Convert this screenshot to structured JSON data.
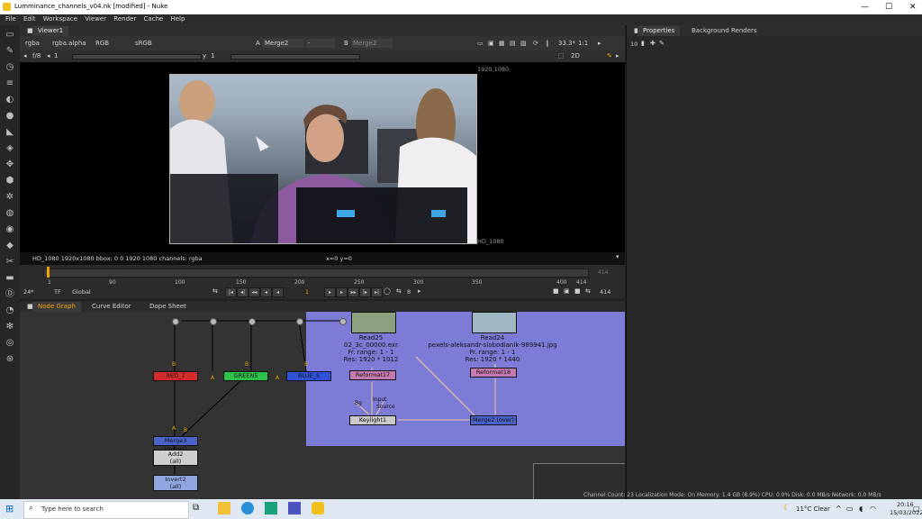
{
  "window": {
    "title": "Lumminance_channels_v04.nk [modified] - Nuke",
    "controls": [
      "—",
      "☐",
      "✕"
    ]
  },
  "menu": [
    "File",
    "Edit",
    "Workspace",
    "Viewer",
    "Render",
    "Cache",
    "Help"
  ],
  "viewer": {
    "tab": "Viewer1",
    "channels": "rgba",
    "alpha": "rgba.alpha",
    "mode": "RGB",
    "lut": "sRGB",
    "a_label": "A",
    "a_input": "Merge2",
    "a_op": "-",
    "b_label": "B",
    "b_input": "Merge2",
    "zoom": "33.3*",
    "ratio": "1:1",
    "fstop": "f/8",
    "frame": "1",
    "y_label": "y",
    "y_value": "1",
    "view_mode": "2D",
    "res_top": "1920,1080",
    "res_bottom": "HD_1080",
    "status_left": "HD_1080 1920x1080  bbox: 0 0 1920 1080 channels: rgba",
    "status_coords": "x=0 y=0"
  },
  "timeline": {
    "ticks": [
      "1",
      "90",
      "100",
      "150",
      "200",
      "250",
      "300",
      "350",
      "400",
      "414"
    ],
    "end_frame": "414",
    "end_frame2": "414",
    "fps": "24*",
    "tf": "TF",
    "scope": "Global",
    "current_frame": "1",
    "step": "8"
  },
  "nodegraph": {
    "tabs": [
      "Node Graph",
      "Curve Editor",
      "Dope Sheet"
    ],
    "nodes": {
      "red": "RED_7",
      "green": "GREEN5",
      "blue": "BLUE_5",
      "merge3": "Merge3 (minus)",
      "add2": "Add2",
      "add2_sub": "(all)",
      "invert2": "Invert2",
      "invert2_sub": "(all)",
      "read25": "Read25",
      "read25_file": "02_3c_00000.exr",
      "read25_range": "Fr. range: 1 - 1",
      "read25_res": "Res: 1920 * 1012",
      "read24": "Read24",
      "read24_file": "pexels-aleksandr-slobodianik-989941.jpg",
      "read24_range": "Fr. range: 1 - 1",
      "read24_res": "Res: 1920 * 1440",
      "reformat17": "Reformat17",
      "reformat18": "Reformat18",
      "keylight": "Keylight1",
      "merge2": "Merge2 (over)",
      "bg": "Bg",
      "input": "Input",
      "source": "Source",
      "a": "A",
      "b": "B"
    }
  },
  "properties": {
    "tabs": [
      "Properties",
      "Background Renders"
    ],
    "count": "10"
  },
  "status": "Channel Count: 23  Localization Mode: On  Memory: 1.4 GB (8.9%)  CPU: 0.0%  Disk: 0.0 MB/s  Network: 0.0 MB/s",
  "taskbar": {
    "search": "Type here to search",
    "weather": "11°C  Clear",
    "time": "20:16",
    "date": "15/03/2022"
  },
  "colors": {
    "accent": "#f2a400",
    "backdrop": "#7c7bd6",
    "red": "#d42b2b",
    "green": "#2fc24a",
    "blue": "#2f52d6"
  }
}
